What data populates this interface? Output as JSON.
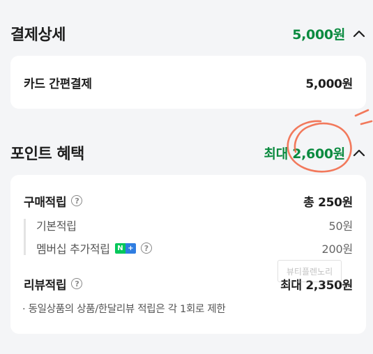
{
  "payment": {
    "title": "결제상세",
    "total": "5,000원",
    "rows": [
      {
        "label": "카드 간편결제",
        "value": "5,000원"
      }
    ]
  },
  "points": {
    "title": "포인트 혜택",
    "max": "최대 2,600원",
    "purchase": {
      "label": "구매적립",
      "value": "총 250원",
      "items": [
        {
          "label": "기본적립",
          "value": "50원"
        },
        {
          "label": "멤버십 추가적립",
          "value": "200원"
        }
      ]
    },
    "review": {
      "label": "리뷰적립",
      "value": "최대 2,350원"
    },
    "note": "· 동일상품의 상품/한달리뷰 적립은 각 1회로 제한"
  },
  "badge": {
    "n": "N",
    "plus": "+"
  },
  "watermark": "뷰티플렌노리",
  "colors": {
    "accent": "#0a8a3f",
    "annotation": "#f26b4a",
    "badge_green": "#03c75a",
    "badge_blue": "#2f7de1"
  }
}
